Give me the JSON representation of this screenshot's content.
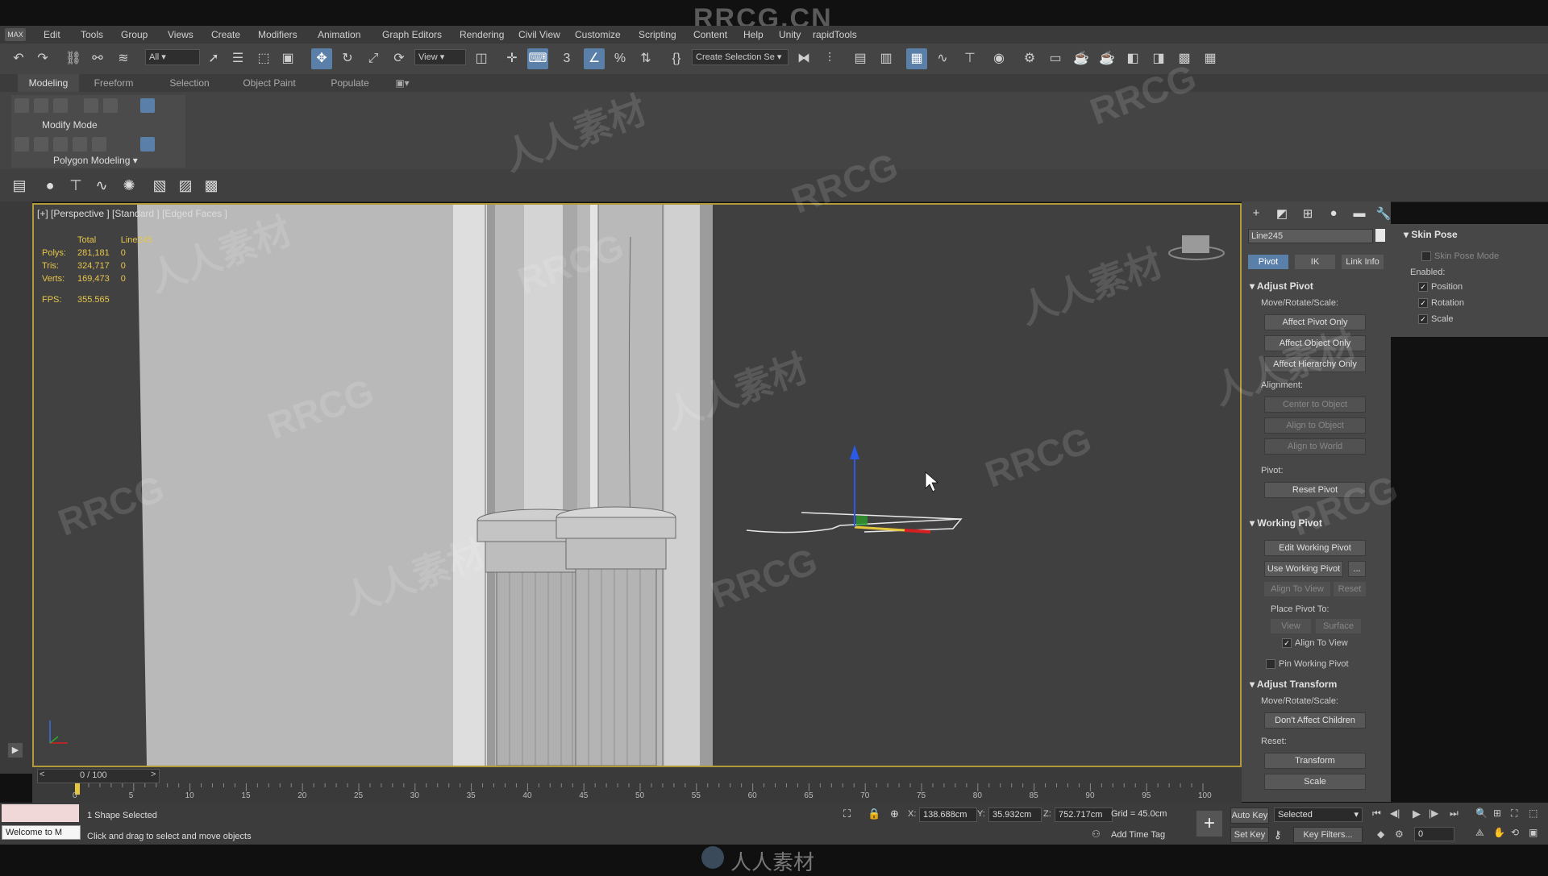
{
  "topbar": {
    "title": "RRCG.CN"
  },
  "menu": [
    "Edit",
    "Tools",
    "Group",
    "Views",
    "Create",
    "Modifiers",
    "Animation",
    "Graph Editors",
    "Rendering",
    "Civil View",
    "Customize",
    "Scripting",
    "Content",
    "Help",
    "Unity",
    "rapidTools"
  ],
  "menu_logo": "MAX",
  "toolbar": {
    "filter_value": "All",
    "refcoord_value": "View",
    "selection_set_placeholder": "Create Selection Se",
    "snap_label": "3"
  },
  "ribbon": {
    "tabs": [
      "Modeling",
      "Freeform",
      "Selection",
      "Object Paint",
      "Populate"
    ],
    "active_tab": "Modeling",
    "modify_mode": "Modify Mode",
    "polygon_modeling": "Polygon Modeling"
  },
  "viewport": {
    "label": "[+] [Perspective ] [Standard ] [Edged Faces ]",
    "stats": {
      "header_total": "Total",
      "header_object": "Line245",
      "rows": [
        {
          "label": "Polys:",
          "total": "281,181",
          "obj": "0"
        },
        {
          "label": "Tris:",
          "total": "324,717",
          "obj": "0"
        },
        {
          "label": "Verts:",
          "total": "169,473",
          "obj": "0"
        }
      ],
      "fps_label": "FPS:",
      "fps_value": "355.565"
    }
  },
  "command_panel": {
    "object_name": "Line245",
    "tabs": [
      "Pivot",
      "IK",
      "Link Info"
    ],
    "adjust_pivot": {
      "title": "Adjust Pivot",
      "mrs": "Move/Rotate/Scale:",
      "buttons": [
        "Affect Pivot Only",
        "Affect Object Only",
        "Affect Hierarchy Only"
      ],
      "alignment": "Alignment:",
      "align_buttons": [
        "Center to Object",
        "Align to Object",
        "Align to World"
      ],
      "pivot": "Pivot:",
      "reset_pivot": "Reset Pivot"
    },
    "working_pivot": {
      "title": "Working Pivot",
      "edit": "Edit Working Pivot",
      "use": "Use Working Pivot",
      "more": "...",
      "align_to_view": "Align To View",
      "reset": "Reset",
      "place_pivot_to": "Place Pivot To:",
      "view": "View",
      "surface": "Surface",
      "align_to_view_chk": "Align To View",
      "pin": "Pin Working Pivot"
    },
    "adjust_transform": {
      "title": "Adjust Transform",
      "mrs": "Move/Rotate/Scale:",
      "dont_affect": "Don't Affect Children",
      "reset": "Reset:",
      "transform": "Transform",
      "scale": "Scale"
    }
  },
  "skin_pose": {
    "title": "Skin Pose",
    "mode": "Skin Pose Mode",
    "enabled": "Enabled:",
    "position": "Position",
    "rotation": "Rotation",
    "scale": "Scale"
  },
  "timeline": {
    "frame": "0 / 100",
    "ticks": [
      "0",
      "5",
      "10",
      "15",
      "20",
      "25",
      "30",
      "35",
      "40",
      "45",
      "50",
      "55",
      "60",
      "65",
      "70",
      "75",
      "80",
      "85",
      "90",
      "95",
      "100"
    ]
  },
  "status": {
    "welcome": "Welcome to M",
    "selected": "1 Shape Selected",
    "hint": "Click and drag to select and move objects",
    "x_label": "X:",
    "x": "138.688cm",
    "y_label": "Y:",
    "y": "35.932cm",
    "z_label": "Z:",
    "z": "752.717cm",
    "grid": "Grid = 45.0cm",
    "add_time_tag": "Add Time Tag",
    "auto_key": "Auto Key",
    "selected_dd": "Selected",
    "set_key": "Set Key",
    "key_filters": "Key Filters...",
    "frame_value": "0"
  },
  "watermarks": {
    "main": "RRCG",
    "cn": "人人素材",
    "footer": "人人素材"
  },
  "colors": {
    "viewport_border": "#b29a3a",
    "active_tab": "#5a7fa8",
    "stats_text": "#e7c64a"
  }
}
